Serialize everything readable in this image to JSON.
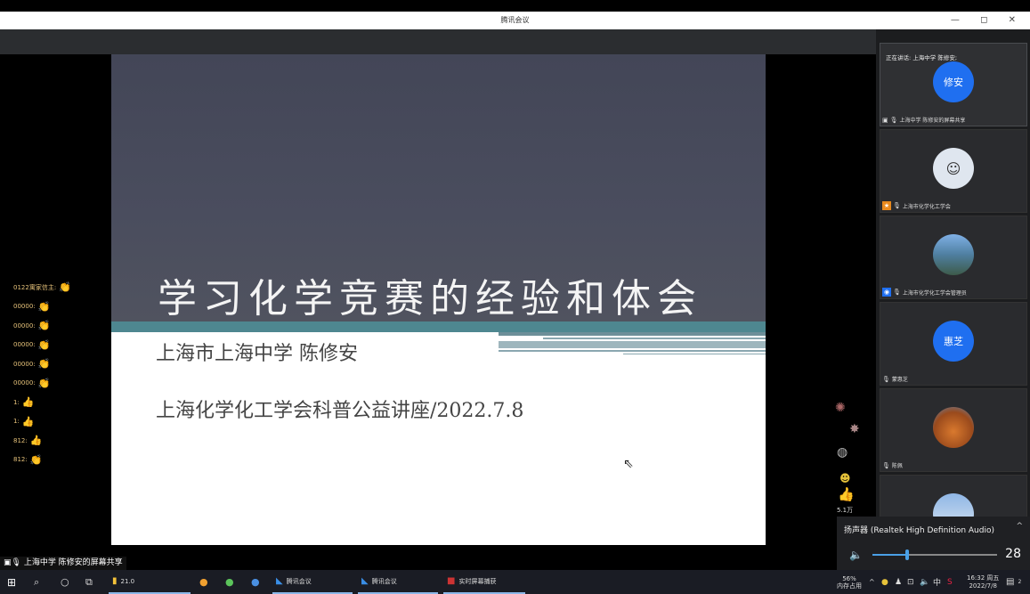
{
  "window": {
    "title": "腾讯会议",
    "controls": [
      "—",
      "◻",
      "✕"
    ]
  },
  "slide": {
    "title": "学习化学竞赛的经验和体会",
    "presenter": "上海市上海中学 陈修安",
    "event": "上海化学化工学会科普公益讲座/2022.7.8"
  },
  "chat": [
    {
      "name": "0122寓家信主:",
      "emoji": "👏"
    },
    {
      "name": "00000:",
      "emoji": "👏"
    },
    {
      "name": "00000:",
      "emoji": "👏"
    },
    {
      "name": "00000:",
      "emoji": "👏"
    },
    {
      "name": "00000:",
      "emoji": "👏"
    },
    {
      "name": "00000:",
      "emoji": "👏"
    },
    {
      "name": "1:",
      "emoji": "👍"
    },
    {
      "name": "1:",
      "emoji": "👍"
    },
    {
      "name": "812:",
      "emoji": "👍"
    },
    {
      "name": "812:",
      "emoji": "👏"
    }
  ],
  "participants": {
    "speaking": "正在讲话: 上海中学 陈修安;",
    "tiles": [
      {
        "avatar_text": "修安",
        "label": "上海中学 陈修安的屏幕共享",
        "avatar_color": "#1f6ff0"
      },
      {
        "avatar_text": "",
        "label": "上海市化学化工学会",
        "avatar_color": "#c9d6e6"
      },
      {
        "avatar_text": "",
        "label": "上海市化学化工学会管理员",
        "avatar_color": "#5f86a8"
      },
      {
        "avatar_text": "惠芝",
        "label": "蒙惠芝",
        "avatar_color": "#1f6ff0"
      },
      {
        "avatar_text": "",
        "label": "陈佩",
        "avatar_color": "#b5602a"
      },
      {
        "avatar_text": "",
        "label": "",
        "avatar_color": "#6c94c4"
      }
    ]
  },
  "reactions": {
    "likes": "5.1万"
  },
  "audio": {
    "device": "扬声器 (Realtek High Definition Audio)",
    "volume": "28",
    "volume_fraction": 0.28
  },
  "share_caption": "上海中学 陈修安的屏幕共享",
  "taskbar": {
    "items": [
      "21.0",
      "腾讯会议",
      "腾讯会议",
      "实时屏幕捕获"
    ],
    "memory_percent": "56%",
    "memory_label": "内存占用",
    "ime": "中",
    "time": "16:32 周五",
    "date": "2022/7/8",
    "notifications": "2"
  }
}
